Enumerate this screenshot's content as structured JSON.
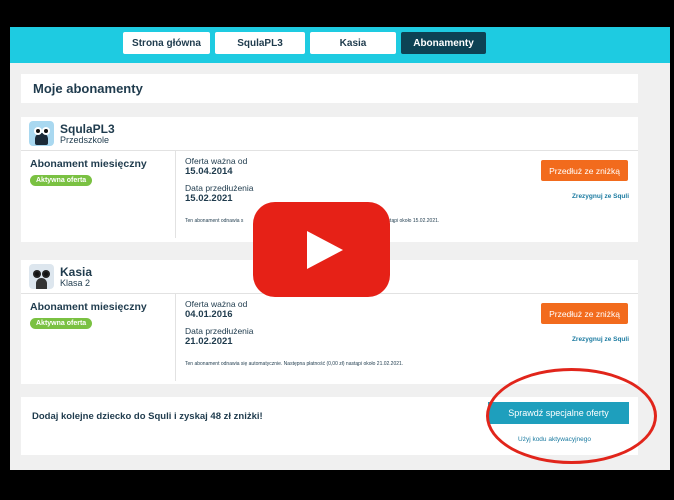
{
  "nav": {
    "tabs": [
      {
        "label": "Strona główna"
      },
      {
        "label": "SqulaPL3"
      },
      {
        "label": "Kasia"
      },
      {
        "label": "Abonamenty"
      }
    ]
  },
  "page_title": "Moje abonamenty",
  "subscriptions": [
    {
      "child_name": "SqulaPL3",
      "child_sub": "Przedszkole",
      "avatar_icon": "penguin-icon",
      "plan": "Abonament miesięczny",
      "badge": "Aktywna oferta",
      "offer_label": "Oferta ważna od",
      "offer_date": "15.04.2014",
      "renew_label": "Data przedłużenia",
      "renew_date": "15.02.2021",
      "note_left": "Ten abonament odnawia s",
      "note_right": "nastąpi około 15.02.2021.",
      "button": "Przedłuż ze zniżką",
      "cancel_link": "Zrezygnuj ze Squli"
    },
    {
      "child_name": "Kasia",
      "child_sub": "Klasa 2",
      "avatar_icon": "panda-icon",
      "plan": "Abonament miesięczny",
      "badge": "Aktywna oferta",
      "offer_label": "Oferta ważna od",
      "offer_date": "04.01.2016",
      "renew_label": "Data przedłużenia",
      "renew_date": "21.02.2021",
      "note": "Ten abonament odnawia się automatycznie. Następna płatność (0,00 zł) nastąpi około 21.02.2021.",
      "button": "Przedłuż ze zniżką",
      "cancel_link": "Zrezygnuj ze Squli"
    }
  ],
  "promo": {
    "text": "Dodaj kolejne dziecko do Squli i zyskaj 48 zł zniżki!",
    "button": "Sprawdź specjalne oferty",
    "link": "Użyj kodu aktywacyjnego"
  },
  "colors": {
    "topbar": "#1ecbe1",
    "active_tab": "#0d4254",
    "badge": "#7ac142",
    "orange_button": "#f26b1d",
    "teal_button": "#1e9fbd",
    "play_button": "#e62117",
    "annotation": "#e1251b"
  }
}
